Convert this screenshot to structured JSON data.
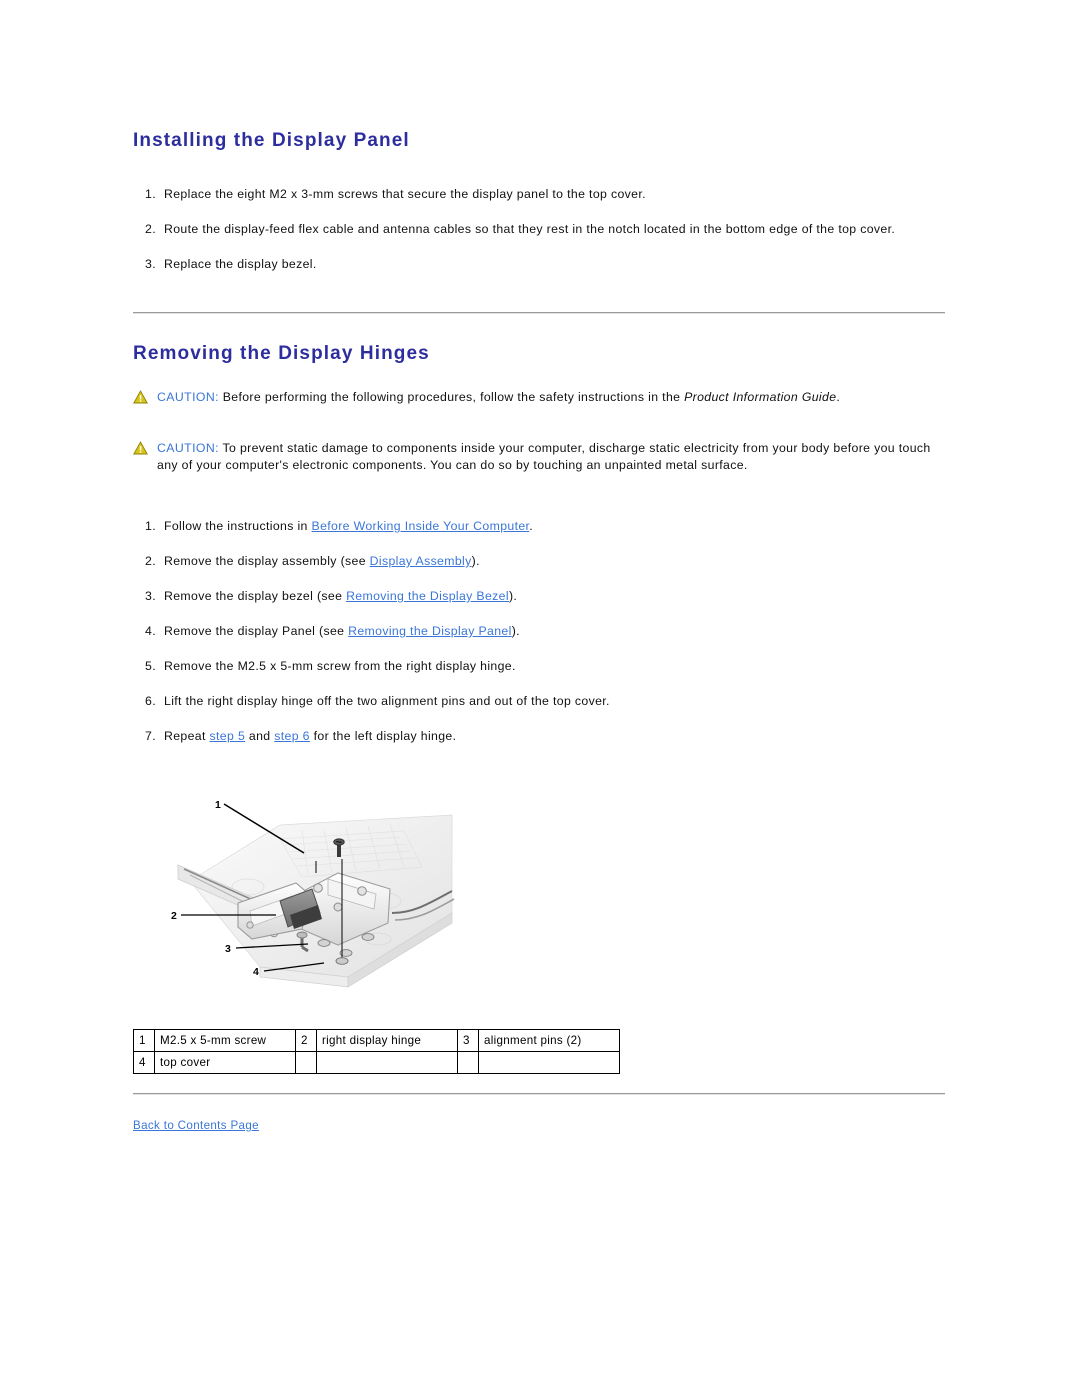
{
  "sections": [
    {
      "id": "installing-display-panel",
      "title": "Installing the Display Panel",
      "steps": [
        {
          "num": "1.",
          "text": "Replace the eight M2 x 3-mm screws that secure the display panel to the top cover."
        },
        {
          "num": "2.",
          "text": "Route the display-feed flex cable and antenna cables so that they rest in the notch located in the bottom edge of the top cover."
        },
        {
          "num": "3.",
          "text": "Replace the display bezel."
        }
      ]
    },
    {
      "id": "removing-display-hinges",
      "title": "Removing the Display Hinges"
    }
  ],
  "cautions": [
    {
      "icon": "warning-triangle-icon",
      "label": "CAUTION:",
      "before": " Before performing the following procedures, follow the safety instructions in the ",
      "emphasis": "Product Information Guide",
      "after": "."
    },
    {
      "icon": "warning-triangle-icon",
      "label": "CAUTION:",
      "before": " To prevent static damage to components inside your computer, discharge static electricity from your body before you touch any of your computer's electronic components. You can do so by touching an unpainted metal surface.",
      "emphasis": "",
      "after": ""
    }
  ],
  "hinge_steps": [
    {
      "num": "1.",
      "pre": "Follow the instructions in ",
      "link": "Before Working Inside Your Computer",
      "post": "."
    },
    {
      "num": "2.",
      "pre": "Remove the display assembly (see ",
      "link": "Display Assembly",
      "post": ")."
    },
    {
      "num": "3.",
      "pre": "Remove the display bezel (see ",
      "link": "Removing the Display Bezel",
      "post": ")."
    },
    {
      "num": "4.",
      "pre": "Remove the display Panel (see ",
      "link": "Removing the Display Panel",
      "post": ")."
    },
    {
      "num": "5.",
      "pre": "Remove the M2.5 x 5-mm screw from the right display hinge.",
      "link": "",
      "post": ""
    },
    {
      "num": "6.",
      "pre": "Lift the right display hinge off the two alignment pins and out of the top cover.",
      "link": "",
      "post": ""
    }
  ],
  "step7": {
    "num": "7.",
    "pre": "Repeat ",
    "link1": "step 5",
    "mid": " and ",
    "link2": "step 6",
    "post": " for the left display hinge."
  },
  "figure": {
    "name": "display-hinge-photo",
    "alt": "Laptop top cover with right display hinge and callouts",
    "callouts": [
      "1",
      "2",
      "3",
      "4"
    ]
  },
  "legend_table": {
    "rows": [
      [
        {
          "idx": "1",
          "label": "M2.5 x 5-mm screw"
        },
        {
          "idx": "2",
          "label": "right display hinge"
        },
        {
          "idx": "3",
          "label": "alignment pins (2)"
        }
      ],
      [
        {
          "idx": "4",
          "label": "top cover"
        },
        {
          "idx": "",
          "label": ""
        },
        {
          "idx": "",
          "label": ""
        }
      ]
    ]
  },
  "footer": {
    "back_link": "Back to Contents Page"
  },
  "colors": {
    "heading": "#2d2d9e",
    "link": "#3a76d8",
    "caution_label": "#3a76d8",
    "body_text": "#111111",
    "rule": "#9a9a9a",
    "warning_triangle": "#d8c516"
  }
}
